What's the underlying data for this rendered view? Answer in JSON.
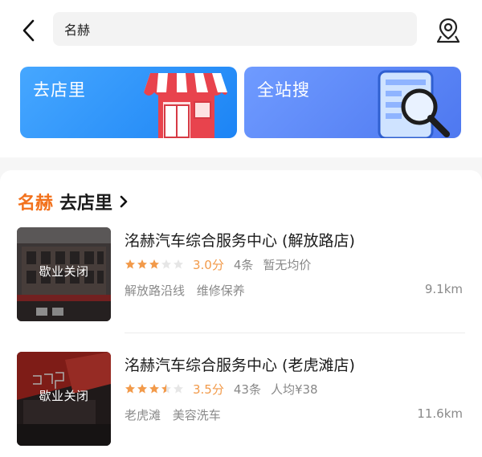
{
  "search": {
    "query": "名赫"
  },
  "banners": [
    {
      "label": "去店里"
    },
    {
      "label": "全站搜"
    }
  ],
  "section": {
    "highlight": "名赫",
    "title": "去店里"
  },
  "stores": [
    {
      "name": "洺赫汽车综合服务中心 (解放路店)",
      "status": "歇业关闭",
      "rating": 3.0,
      "score_text": "3.0分",
      "reviews": "4条",
      "price": "暂无均价",
      "tags": [
        "解放路沿线",
        "维修保养"
      ],
      "distance": "9.1km"
    },
    {
      "name": "洺赫汽车综合服务中心 (老虎滩店)",
      "status": "歇业关闭",
      "rating": 3.5,
      "score_text": "3.5分",
      "reviews": "43条",
      "price": "人均¥38",
      "tags": [
        "老虎滩",
        "美容洗车"
      ],
      "distance": "11.6km"
    }
  ],
  "colors": {
    "accent": "#f2711c",
    "star": "#f29a4a",
    "star_empty": "#e6e6e6",
    "banner_left": "#2a93ff",
    "banner_right": "#5b86f5"
  }
}
